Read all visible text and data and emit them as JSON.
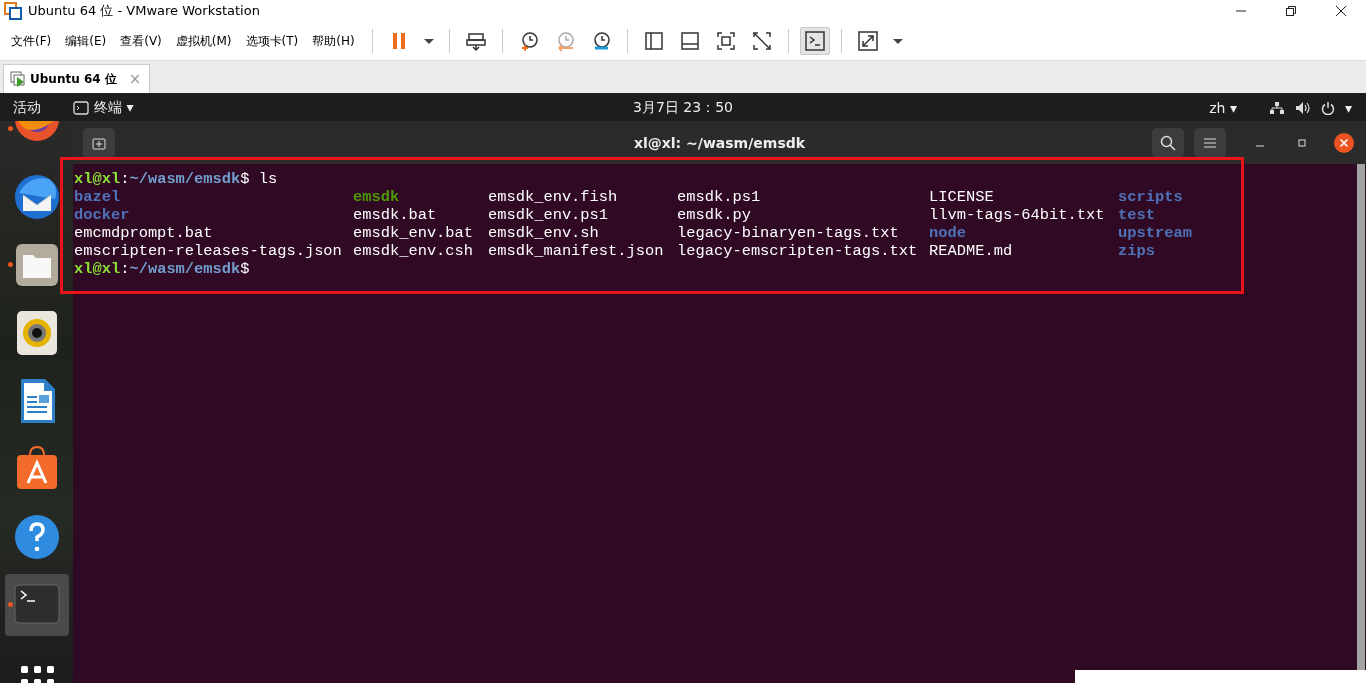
{
  "window": {
    "title": "Ubuntu 64 位 - VMware Workstation"
  },
  "menu": [
    "文件(F)",
    "编辑(E)",
    "查看(V)",
    "虚拟机(M)",
    "选项卡(T)",
    "帮助(H)"
  ],
  "toolbar": [
    [
      {
        "kind": "pause",
        "selected": false
      },
      {
        "kind": "caret",
        "selected": false
      }
    ],
    [
      {
        "kind": "send-keys",
        "selected": false
      }
    ],
    [
      {
        "kind": "snapshot",
        "selected": false
      },
      {
        "kind": "revert",
        "selected": false
      },
      {
        "kind": "manage",
        "selected": false
      }
    ],
    [
      {
        "kind": "library",
        "selected": false
      },
      {
        "kind": "thumbnail",
        "selected": false
      },
      {
        "kind": "fullscreen",
        "selected": false
      },
      {
        "kind": "unity",
        "selected": false
      }
    ],
    [
      {
        "kind": "console",
        "selected": true
      }
    ],
    [
      {
        "kind": "stretch",
        "selected": false
      },
      {
        "kind": "caret",
        "selected": false
      }
    ]
  ],
  "tabs": [
    {
      "label": "Ubuntu 64 位",
      "close": "×",
      "selected": true
    }
  ],
  "top_bar": {
    "activities": "活动",
    "app_menu": "终端",
    "app_caret": "▾",
    "clock": "3月7日  23：50",
    "language": "zh",
    "language_caret": "▾",
    "system_caret": "▾"
  },
  "dock": [
    {
      "kind": "browser",
      "running": true,
      "selected": false
    },
    {
      "kind": "mail",
      "running": false,
      "selected": false
    },
    {
      "kind": "files",
      "running": true,
      "selected": false
    },
    {
      "kind": "music",
      "running": false,
      "selected": false
    },
    {
      "kind": "writer",
      "running": false,
      "selected": false
    },
    {
      "kind": "store",
      "running": false,
      "selected": false
    },
    {
      "kind": "help",
      "running": false,
      "selected": false
    },
    {
      "kind": "terminal",
      "running": true,
      "selected": true
    },
    {
      "kind": "apps",
      "running": false,
      "selected": false
    }
  ],
  "terminal": {
    "title": "xl@xl: ~/wasm/emsdk",
    "lines": [
      {
        "kind": "prompt",
        "user": "xl@xl",
        "separator": ":",
        "path": "~/wasm/emsdk",
        "symbol": "$",
        "command": " ls"
      },
      {
        "kind": "listing",
        "entries": [
          {
            "name": "bazel",
            "kind": "dir"
          },
          {
            "name": "emsdk",
            "kind": "exec"
          },
          {
            "name": "emsdk_env.fish",
            "kind": "file"
          },
          {
            "name": "emsdk.ps1",
            "kind": "file"
          },
          {
            "name": "LICENSE",
            "kind": "file"
          },
          {
            "name": "scripts",
            "kind": "dir"
          }
        ]
      },
      {
        "kind": "listing",
        "entries": [
          {
            "name": "docker",
            "kind": "dir"
          },
          {
            "name": "emsdk.bat",
            "kind": "file"
          },
          {
            "name": "emsdk_env.ps1",
            "kind": "file"
          },
          {
            "name": "emsdk.py",
            "kind": "file"
          },
          {
            "name": "llvm-tags-64bit.txt",
            "kind": "file"
          },
          {
            "name": "test",
            "kind": "dir"
          }
        ]
      },
      {
        "kind": "listing",
        "entries": [
          {
            "name": "emcmdprompt.bat",
            "kind": "file"
          },
          {
            "name": "emsdk_env.bat",
            "kind": "file"
          },
          {
            "name": "emsdk_env.sh",
            "kind": "file"
          },
          {
            "name": "legacy-binaryen-tags.txt",
            "kind": "file"
          },
          {
            "name": "node",
            "kind": "dir"
          },
          {
            "name": "upstream",
            "kind": "dir"
          }
        ]
      },
      {
        "kind": "listing",
        "entries": [
          {
            "name": "emscripten-releases-tags.json",
            "kind": "file"
          },
          {
            "name": "emsdk_env.csh",
            "kind": "file"
          },
          {
            "name": "emsdk_manifest.json",
            "kind": "file"
          },
          {
            "name": "legacy-emscripten-tags.txt",
            "kind": "file"
          },
          {
            "name": "README.md",
            "kind": "file"
          },
          {
            "name": "zips",
            "kind": "dir"
          }
        ]
      },
      {
        "kind": "prompt",
        "user": "xl@xl",
        "separator": ":",
        "path": "~/wasm/emsdk",
        "symbol": "$"
      }
    ]
  }
}
